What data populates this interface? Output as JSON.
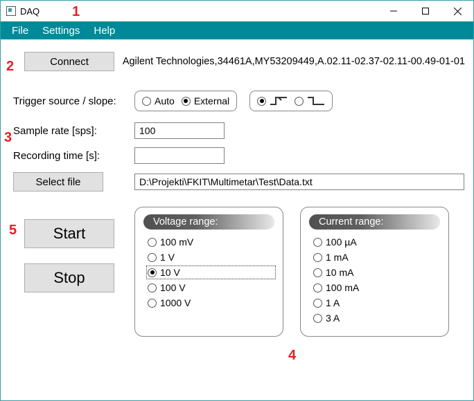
{
  "window": {
    "title": "DAQ"
  },
  "menu": {
    "file": "File",
    "settings": "Settings",
    "help": "Help"
  },
  "connect": {
    "label": "Connect",
    "device_id": "Agilent Technologies,34461A,MY53209449,A.02.11-02.37-02.11-00.49-01-01"
  },
  "trigger": {
    "label": "Trigger source / slope:",
    "source": {
      "auto": "Auto",
      "external": "External",
      "selected": "external"
    },
    "slope": {
      "selected": "rising"
    }
  },
  "sample_rate": {
    "label": "Sample rate [sps]:",
    "value": "100"
  },
  "recording_time": {
    "label": "Recording time [s]:",
    "value": ""
  },
  "file": {
    "button": "Select file",
    "path": "D:\\Projekti\\FKIT\\Multimetar\\Test\\Data.txt"
  },
  "actions": {
    "start": "Start",
    "stop": "Stop"
  },
  "voltage_range": {
    "header": "Voltage range:",
    "options": [
      "100 mV",
      "1 V",
      "10 V",
      "100 V",
      "1000 V"
    ],
    "selected": "10 V"
  },
  "current_range": {
    "header": "Current range:",
    "options": [
      "100 µA",
      "1 mA",
      "10 mA",
      "100 mA",
      "1 A",
      "3 A"
    ],
    "selected": ""
  },
  "annotations": {
    "1": "1",
    "2": "2",
    "3": "3",
    "4": "4",
    "5": "5"
  }
}
